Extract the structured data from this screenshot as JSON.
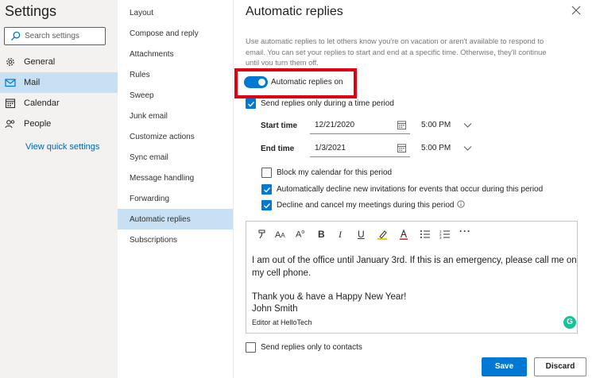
{
  "left_nav": {
    "title": "Settings",
    "search_placeholder": "Search settings",
    "items": [
      {
        "label": "General",
        "icon": "gear-icon"
      },
      {
        "label": "Mail",
        "icon": "mail-icon"
      },
      {
        "label": "Calendar",
        "icon": "calendar-icon"
      },
      {
        "label": "People",
        "icon": "people-icon"
      }
    ],
    "active_item": "Mail",
    "quick_settings_link": "View quick settings"
  },
  "mail_settings": {
    "items": [
      "Layout",
      "Compose and reply",
      "Attachments",
      "Rules",
      "Sweep",
      "Junk email",
      "Customize actions",
      "Sync email",
      "Message handling",
      "Forwarding",
      "Automatic replies",
      "Subscriptions"
    ],
    "active_item": "Automatic replies"
  },
  "pane": {
    "title": "Automatic replies",
    "description_lines": [
      "Use automatic replies to let others know you're on vacation or aren't available to respond to",
      "email. You can set your replies to start and end at a specific time. Otherwise, they'll continue",
      "until you turn them off."
    ],
    "toggle_label": "Automatic replies on",
    "toggle_on": true,
    "time_period_label": "Send replies only during a time period",
    "time_period_checked": true,
    "start_label": "Start time",
    "start_date": "12/21/2020",
    "start_time": "5:00 PM",
    "end_label": "End time",
    "end_date": "1/3/2021",
    "end_time": "5:00 PM",
    "options": [
      {
        "label": "Block my calendar for this period",
        "checked": false
      },
      {
        "label": "Automatically decline new invitations for events that occur during this period",
        "checked": true
      },
      {
        "label": "Decline and cancel my meetings during this period",
        "checked": true
      }
    ],
    "message_lines": [
      "I am out of the office until January 3rd. If this is an emergency, please call me on",
      "my cell phone.",
      "Thank you & have a Happy New Year!",
      "John Smith"
    ],
    "signature_line": "Editor at HelloTech",
    "contacts_only_label": "Send replies only to contacts",
    "contacts_only_checked": false,
    "save_label": "Save",
    "discard_label": "Discard"
  },
  "colors": {
    "accent": "#0078d4",
    "selection": "#c7e0f4",
    "highlight_box": "#e00010",
    "grammarly": "#15c39a"
  }
}
